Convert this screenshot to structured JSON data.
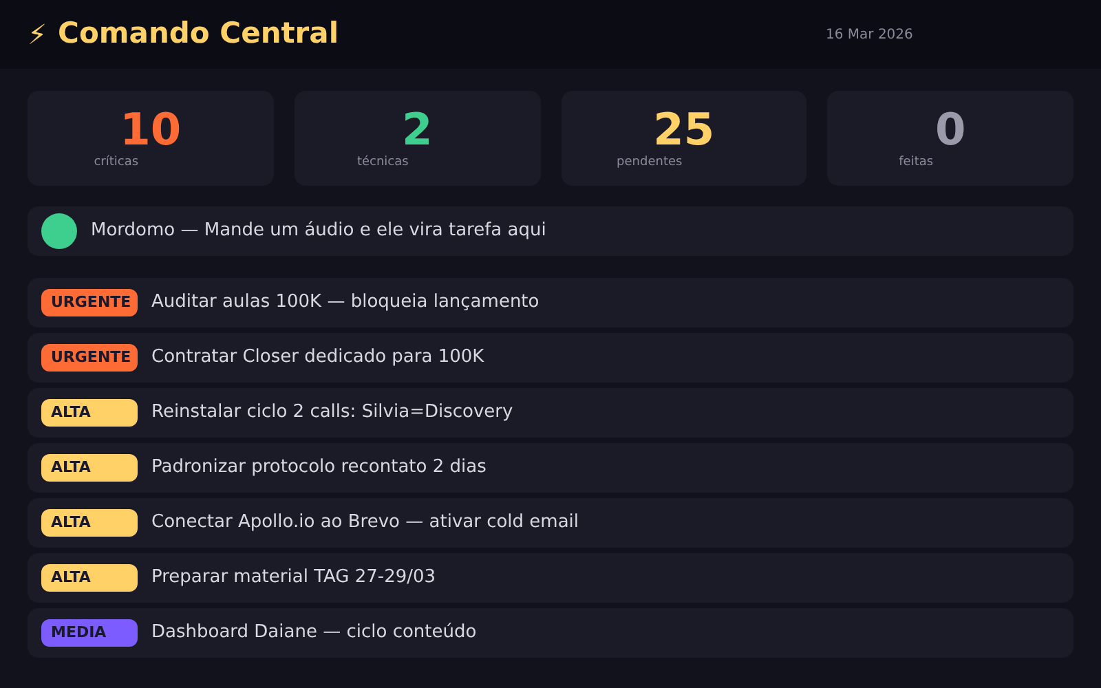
{
  "header": {
    "icon": "⚡",
    "title": "Comando Central",
    "date": "16 Mar 2026"
  },
  "stats": [
    {
      "value": "10",
      "label": "críticas",
      "color": "#ff6b35"
    },
    {
      "value": "2",
      "label": "técnicas",
      "color": "#3ecf8e"
    },
    {
      "value": "25",
      "label": "pendentes",
      "color": "#ffd166"
    },
    {
      "value": "0",
      "label": "feitas",
      "color": "#9a9aaa"
    }
  ],
  "assistant": {
    "text": "Mordomo — Mande um áudio e ele vira tarefa aqui"
  },
  "tasks": [
    {
      "priority": "URGENTE",
      "color": "#ff6b35",
      "title": "Auditar aulas 100K — bloqueia lançamento"
    },
    {
      "priority": "URGENTE",
      "color": "#ff6b35",
      "title": "Contratar Closer dedicado para 100K"
    },
    {
      "priority": "ALTA",
      "color": "#ffd166",
      "title": "Reinstalar ciclo 2 calls: Silvia=Discovery"
    },
    {
      "priority": "ALTA",
      "color": "#ffd166",
      "title": "Padronizar protocolo recontato 2 dias"
    },
    {
      "priority": "ALTA",
      "color": "#ffd166",
      "title": "Conectar Apollo.io ao Brevo — ativar cold email"
    },
    {
      "priority": "ALTA",
      "color": "#ffd166",
      "title": "Preparar material TAG 27-29/03"
    },
    {
      "priority": "MEDIA",
      "color": "#7c5cff",
      "title": "Dashboard Daiane — ciclo conteúdo"
    }
  ]
}
